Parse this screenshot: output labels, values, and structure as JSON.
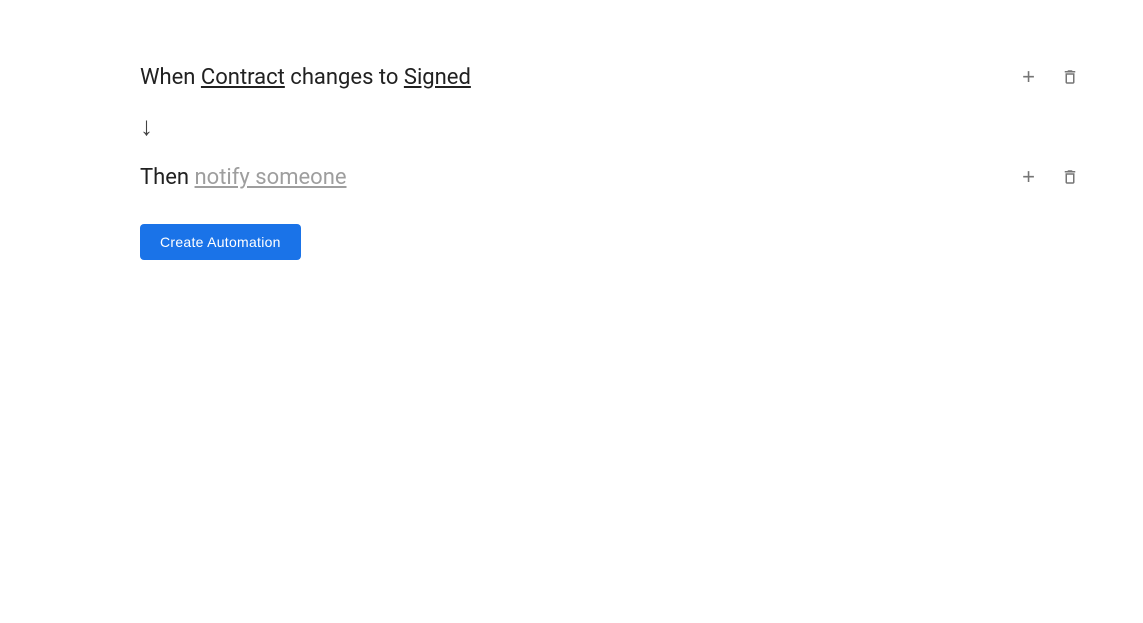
{
  "trigger": {
    "prefix": "When ",
    "subject": "Contract",
    "middle": " changes to ",
    "value": "Signed"
  },
  "arrow": "↓",
  "action": {
    "prefix": "Then ",
    "verb": "notify someone"
  },
  "buttons": {
    "add_label": "+",
    "create_automation_label": "Create Automation"
  },
  "colors": {
    "primary_blue": "#1a73e8",
    "text_dark": "#212121",
    "text_muted": "#9e9e9e",
    "icon_color": "#757575"
  }
}
